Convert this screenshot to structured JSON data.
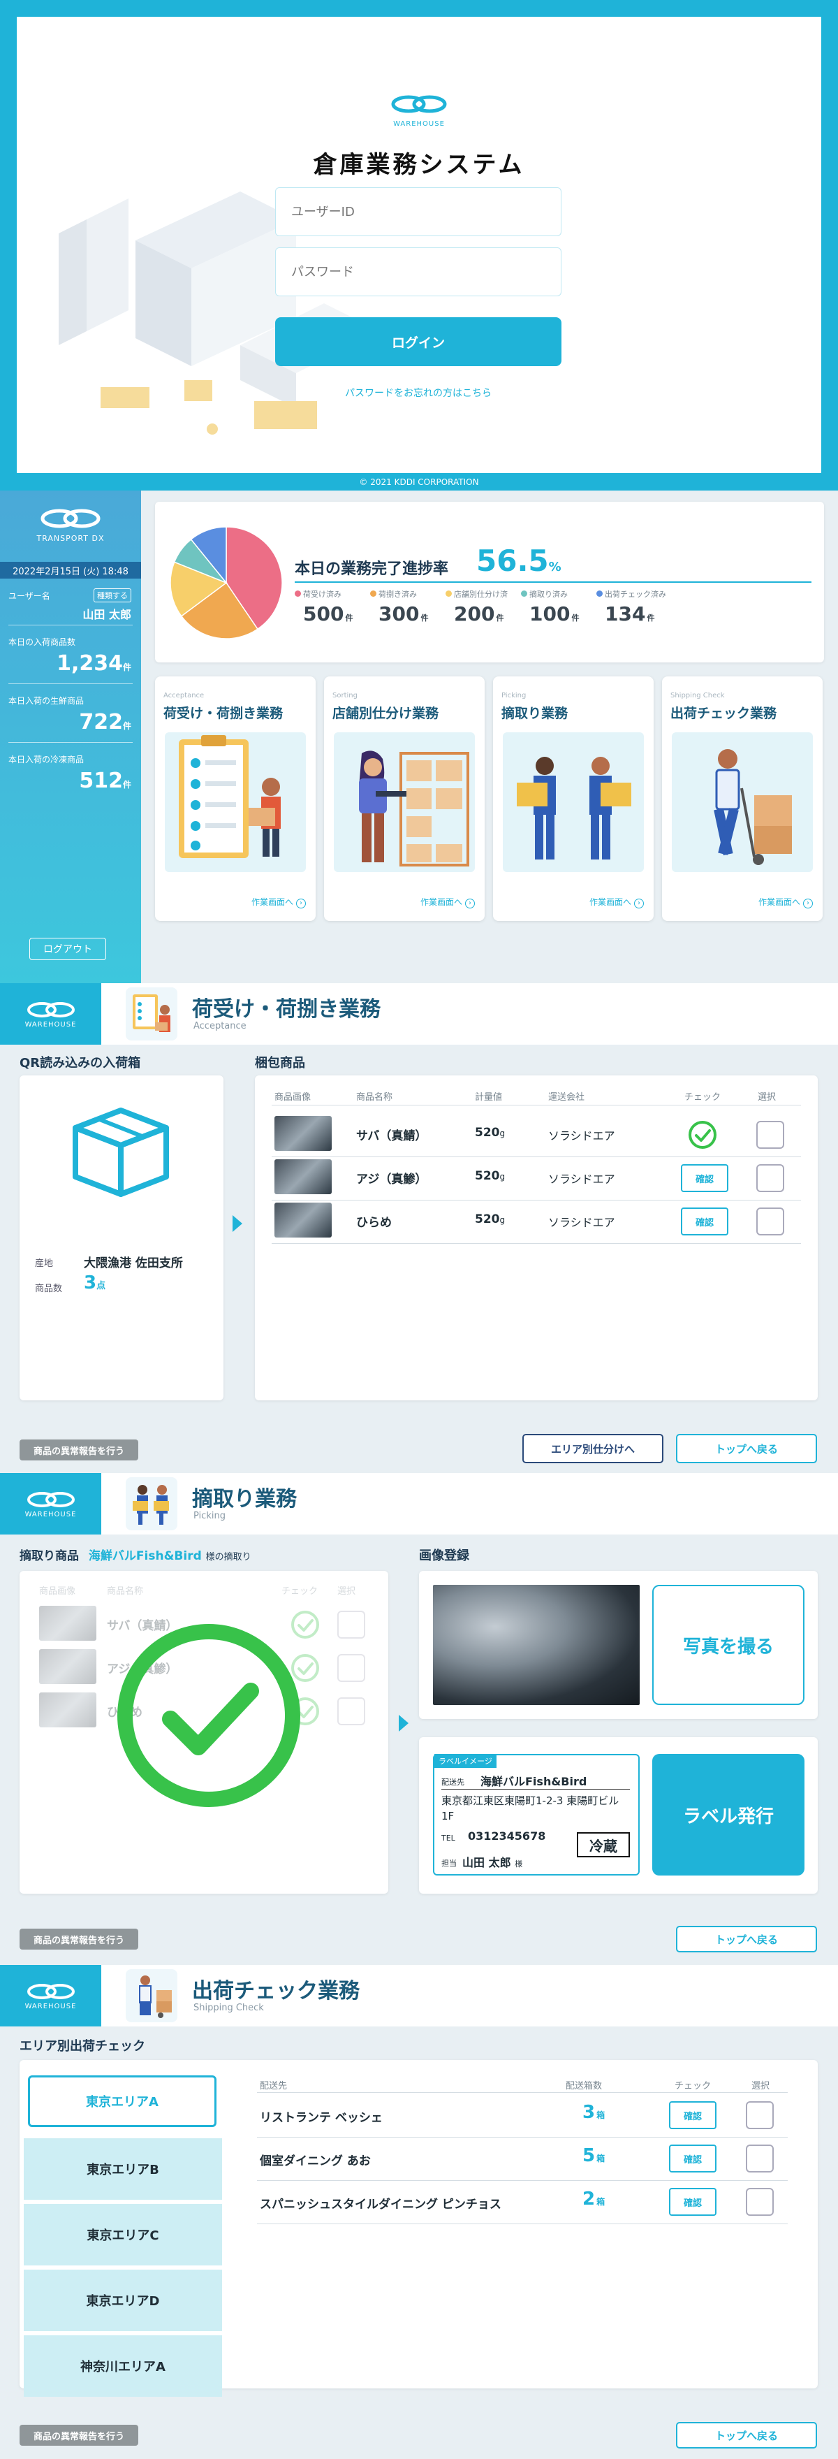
{
  "login": {
    "logo_text": "WAREHOUSE",
    "title": "倉庫業務システム",
    "user_placeholder": "ユーザーID",
    "password_placeholder": "パスワード",
    "login_button": "ログイン",
    "forgot": "パスワードをお忘れの方はこちら",
    "copyright": "© 2021 KDDI CORPORATION"
  },
  "dashboard": {
    "sidebar": {
      "logo_text": "TRANSPORT DX",
      "datetime": "2022年2月15日 (火) 18:48",
      "user_label": "ユーザー名",
      "change_label": "種類する",
      "user_name": "山田 太郎",
      "stat1_label": "本日の入荷商品数",
      "stat1_value": "1,234",
      "stat2_label": "本日入荷の生鮮商品",
      "stat2_value": "722",
      "stat3_label": "本日入荷の冷凍商品",
      "stat3_value": "512",
      "unit": "件",
      "logout": "ログアウト"
    },
    "progress": {
      "title": "本日の業務完了進捗率",
      "rate": "56.5",
      "pct": "%",
      "unit": "件",
      "items": [
        {
          "label": "荷受け済み",
          "value": "500",
          "color": "#ec6e86"
        },
        {
          "label": "荷捌き済み",
          "value": "300",
          "color": "#f0a850"
        },
        {
          "label": "店舗別仕分け済",
          "value": "200",
          "color": "#f7cf6a"
        },
        {
          "label": "摘取り済み",
          "value": "100",
          "color": "#6fc4c0"
        },
        {
          "label": "出荷チェック済み",
          "value": "134",
          "color": "#5a8ee0"
        }
      ]
    },
    "tasks": [
      {
        "en": "Acceptance",
        "jp": "荷受け・荷捌き業務",
        "link": "作業画面へ"
      },
      {
        "en": "Sorting",
        "jp": "店舗別仕分け業務",
        "link": "作業画面へ"
      },
      {
        "en": "Picking",
        "jp": "摘取り業務",
        "link": "作業画面へ"
      },
      {
        "en": "Shipping Check",
        "jp": "出荷チェック業務",
        "link": "作業画面へ"
      }
    ]
  },
  "acceptance": {
    "logo_text": "WAREHOUSE",
    "title": "荷受け・荷捌き業務",
    "subtitle": "Acceptance",
    "qr_label": "QR読み込みの入荷箱",
    "origin_label": "産地",
    "origin_value": "大隈漁港 佐田支所",
    "count_label": "商品数",
    "count_value": "3",
    "count_unit": "点",
    "packing_label": "梱包商品",
    "headers": [
      "商品画像",
      "商品名称",
      "計量値",
      "運送会社",
      "チェック",
      "選択"
    ],
    "rows": [
      {
        "name": "サバ（真鯖）",
        "weight": "520",
        "unit": "g",
        "company": "ソラシドエア",
        "check": "確認"
      },
      {
        "name": "アジ（真鯵）",
        "weight": "520",
        "unit": "g",
        "company": "ソラシドエア",
        "check": "確認"
      },
      {
        "name": "ひらめ",
        "weight": "520",
        "unit": "g",
        "company": "ソラシドエア",
        "check": "確認"
      }
    ],
    "report": "商品の異常報告を行う",
    "area_btn": "エリア別仕分けへ",
    "top_btn": "トップへ戻る"
  },
  "picking": {
    "logo_text": "WAREHOUSE",
    "title": "摘取り業務",
    "subtitle": "Picking",
    "label_prefix": "摘取り商品",
    "shop": "海鮮バルFish&Bird",
    "label_suffix": "様の摘取り",
    "headers": [
      "商品画像",
      "商品名称",
      "チェック",
      "選択"
    ],
    "rows": [
      "サバ（真鯖）",
      "アジ（真鯵）",
      "ひらめ"
    ],
    "image_label": "画像登録",
    "photo_btn": "写真を撮る",
    "label_image": "ラベルイメージ",
    "to_label": "配送先",
    "to_value": "海鮮バルFish&Bird",
    "address": "東京都江東区東陽町1-2-3 東陽町ビル1F",
    "tel_label": "TEL",
    "tel": "0312345678",
    "cold": "冷蔵",
    "person_label": "担当",
    "person": "山田 太郎",
    "person_suffix": "様",
    "label_btn": "ラベル発行",
    "report": "商品の異常報告を行う",
    "top_btn": "トップへ戻る"
  },
  "shipping": {
    "logo_text": "WAREHOUSE",
    "title": "出荷チェック業務",
    "subtitle": "Shipping Check",
    "area_label": "エリア別出荷チェック",
    "areas": [
      "東京エリアA",
      "東京エリアB",
      "東京エリアC",
      "東京エリアD",
      "神奈川エリアA"
    ],
    "headers": [
      "配送先",
      "配送箱数",
      "チェック",
      "選択"
    ],
    "rows": [
      {
        "dest": "リストランテ ベッシェ",
        "count": "3",
        "check": "確認"
      },
      {
        "dest": "個室ダイニング あお",
        "count": "5",
        "check": "確認"
      },
      {
        "dest": "スパニッシュスタイルダイニング ピンチョス",
        "count": "2",
        "check": "確認"
      }
    ],
    "box_unit": "箱",
    "report": "商品の異常報告を行う",
    "top_btn": "トップへ戻る"
  },
  "colors": {
    "accent": "#1fb3d8",
    "navy": "#1b5a7a",
    "green": "#38c24a"
  }
}
